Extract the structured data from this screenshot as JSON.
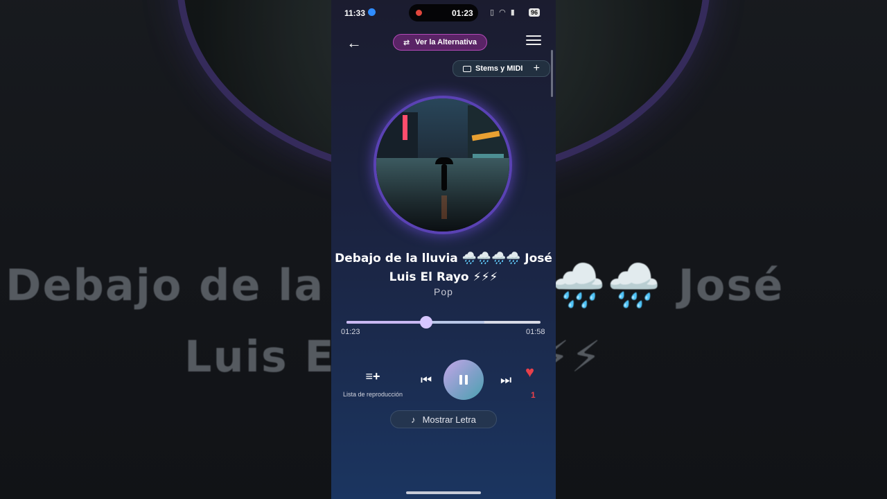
{
  "status_bar": {
    "time": "11:33",
    "recording_time": "01:23",
    "battery": "96",
    "icons": [
      "vibrate-icon",
      "wifi-icon",
      "signal-icon"
    ]
  },
  "header": {
    "alt_button": "Ver la Alternativa",
    "stems_button": "Stems y MIDI"
  },
  "song": {
    "title": "Debajo de la lluvia 🌧️🌧️🌧️🌧️ José Luis El Rayo ⚡⚡⚡",
    "genre": "Pop"
  },
  "background": {
    "line1": "Debajo de la lluvia 🌧️🌧️🌧️ José",
    "line2": "Luis El Rayo ⚡⚡⚡"
  },
  "player": {
    "current_time": "01:23",
    "total_time": "01:58",
    "progress_fraction": 0.41,
    "buffered_fraction": 0.71,
    "playlist_label": "Lista de reproducción",
    "like_count": "1",
    "lyrics_button": "Mostrar Letra"
  },
  "colors": {
    "accent": "#b44ab8",
    "like": "#e8404a"
  }
}
